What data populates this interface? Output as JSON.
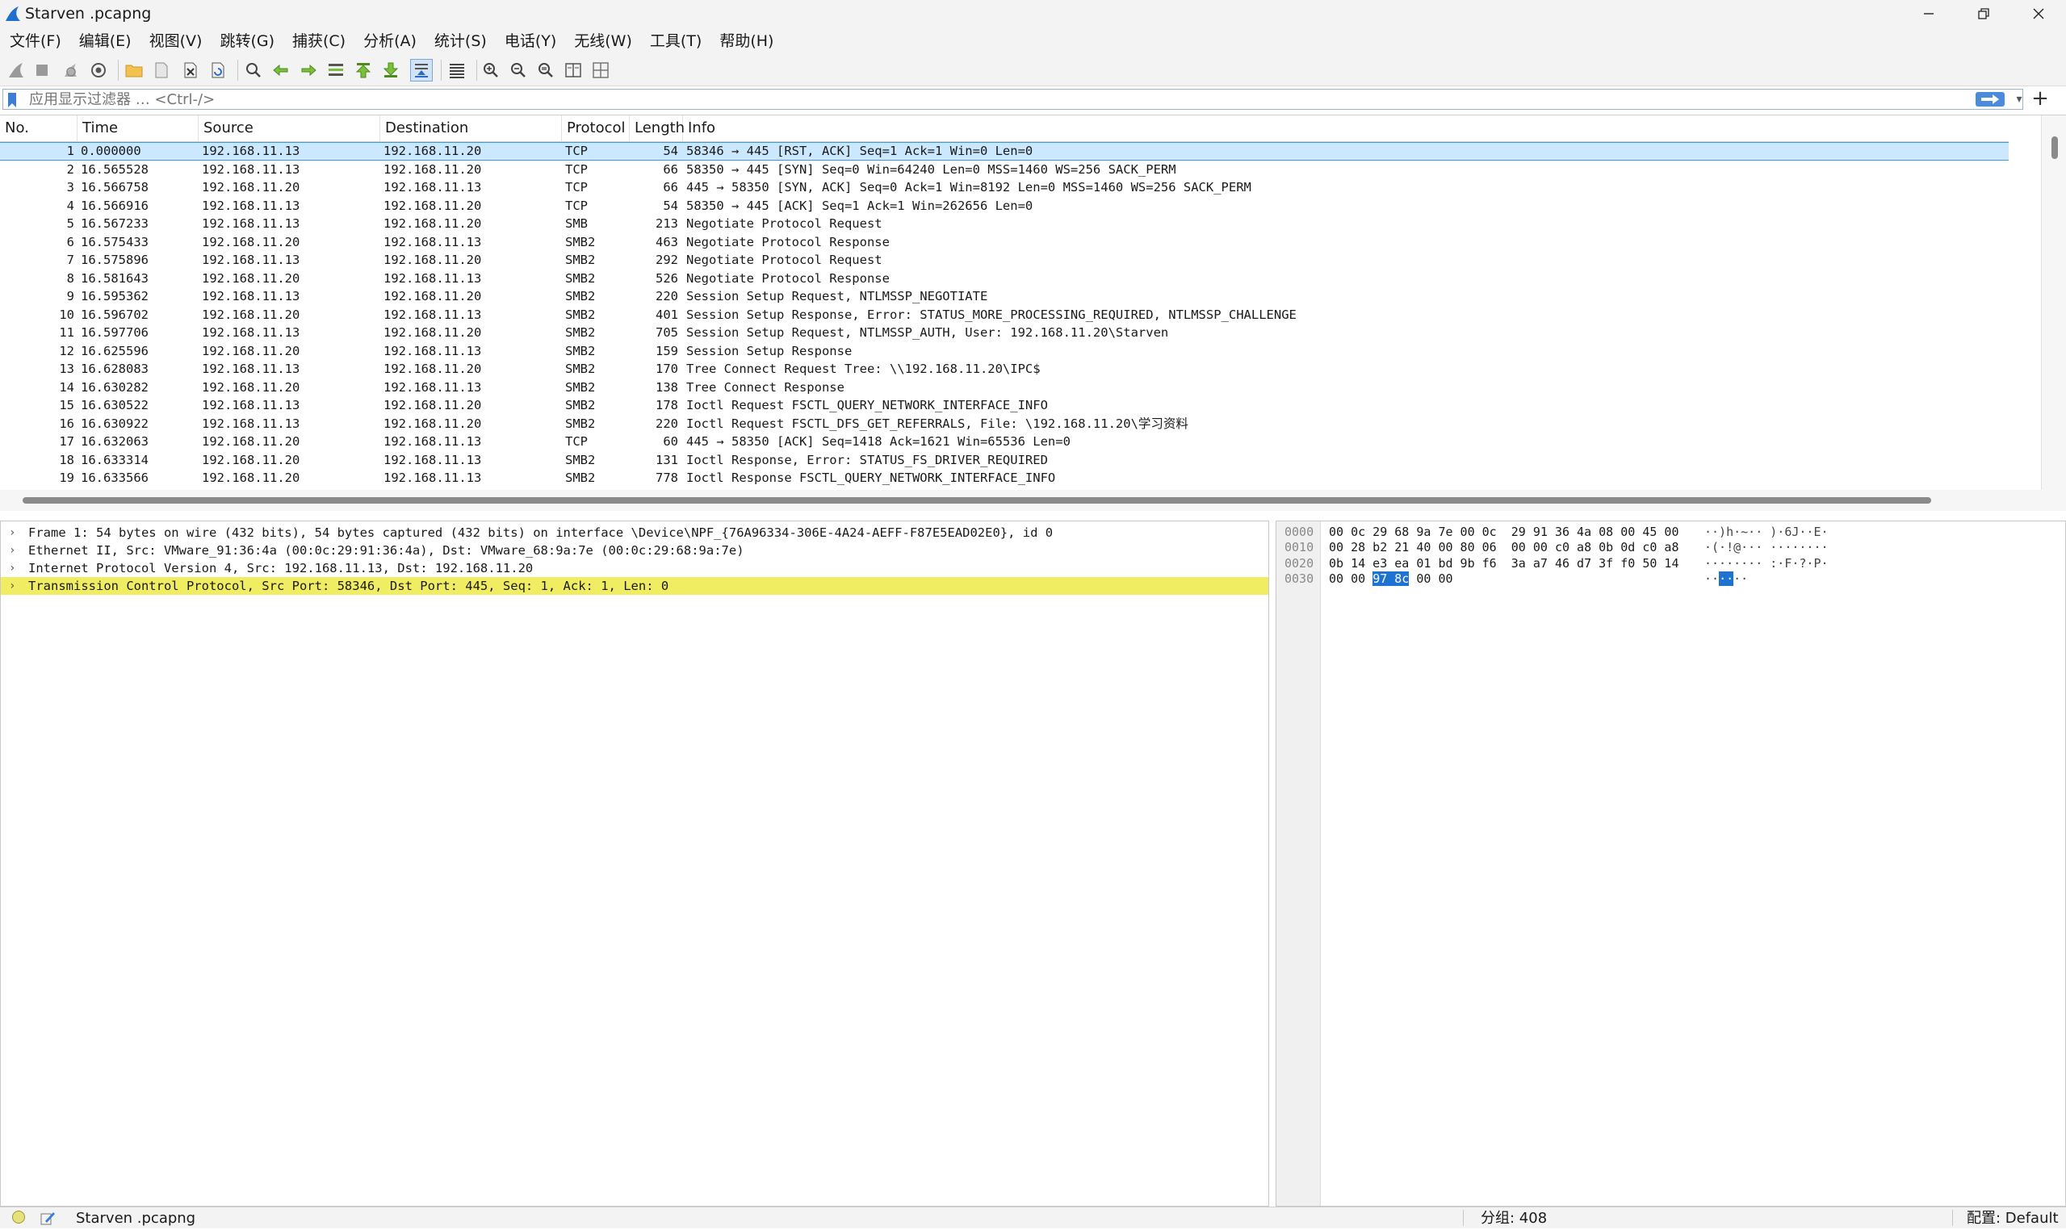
{
  "window": {
    "title": "Starven .pcapng",
    "controls": [
      "minimize",
      "restore",
      "close"
    ]
  },
  "menu": [
    "文件(F)",
    "编辑(E)",
    "视图(V)",
    "跳转(G)",
    "捕获(C)",
    "分析(A)",
    "统计(S)",
    "电话(Y)",
    "无线(W)",
    "工具(T)",
    "帮助(H)"
  ],
  "toolbar": {
    "icons": [
      "shark-fin-start-icon",
      "stop-capture-icon",
      "restart-capture-icon",
      "capture-options-icon",
      "open-file-icon",
      "save-file-icon",
      "close-file-icon",
      "reload-file-icon",
      "find-packet-icon",
      "go-back-icon",
      "go-forward-icon",
      "go-to-packet-icon",
      "go-first-icon",
      "go-last-icon",
      "autoscroll-icon",
      "colorize-icon",
      "zoom-in-icon",
      "zoom-out-icon",
      "zoom-normal-icon",
      "resize-columns-icon",
      "expand-subtrees-icon"
    ]
  },
  "filter": {
    "placeholder": "应用显示过滤器 … <Ctrl-/>",
    "value": ""
  },
  "packet_list": {
    "columns": [
      "No.",
      "Time",
      "Source",
      "Destination",
      "Protocol",
      "Length",
      "Info"
    ],
    "rows": [
      {
        "no": "1",
        "time": "0.000000",
        "src": "192.168.11.13",
        "dst": "192.168.11.20",
        "proto": "TCP",
        "len": "54",
        "info": "58346 → 445 [RST, ACK] Seq=1 Ack=1 Win=0 Len=0"
      },
      {
        "no": "2",
        "time": "16.565528",
        "src": "192.168.11.13",
        "dst": "192.168.11.20",
        "proto": "TCP",
        "len": "66",
        "info": "58350 → 445 [SYN] Seq=0 Win=64240 Len=0 MSS=1460 WS=256 SACK_PERM"
      },
      {
        "no": "3",
        "time": "16.566758",
        "src": "192.168.11.20",
        "dst": "192.168.11.13",
        "proto": "TCP",
        "len": "66",
        "info": "445 → 58350 [SYN, ACK] Seq=0 Ack=1 Win=8192 Len=0 MSS=1460 WS=256 SACK_PERM"
      },
      {
        "no": "4",
        "time": "16.566916",
        "src": "192.168.11.13",
        "dst": "192.168.11.20",
        "proto": "TCP",
        "len": "54",
        "info": "58350 → 445 [ACK] Seq=1 Ack=1 Win=262656 Len=0"
      },
      {
        "no": "5",
        "time": "16.567233",
        "src": "192.168.11.13",
        "dst": "192.168.11.20",
        "proto": "SMB",
        "len": "213",
        "info": "Negotiate Protocol Request"
      },
      {
        "no": "6",
        "time": "16.575433",
        "src": "192.168.11.20",
        "dst": "192.168.11.13",
        "proto": "SMB2",
        "len": "463",
        "info": "Negotiate Protocol Response"
      },
      {
        "no": "7",
        "time": "16.575896",
        "src": "192.168.11.13",
        "dst": "192.168.11.20",
        "proto": "SMB2",
        "len": "292",
        "info": "Negotiate Protocol Request"
      },
      {
        "no": "8",
        "time": "16.581643",
        "src": "192.168.11.20",
        "dst": "192.168.11.13",
        "proto": "SMB2",
        "len": "526",
        "info": "Negotiate Protocol Response"
      },
      {
        "no": "9",
        "time": "16.595362",
        "src": "192.168.11.13",
        "dst": "192.168.11.20",
        "proto": "SMB2",
        "len": "220",
        "info": "Session Setup Request, NTLMSSP_NEGOTIATE"
      },
      {
        "no": "10",
        "time": "16.596702",
        "src": "192.168.11.20",
        "dst": "192.168.11.13",
        "proto": "SMB2",
        "len": "401",
        "info": "Session Setup Response, Error: STATUS_MORE_PROCESSING_REQUIRED, NTLMSSP_CHALLENGE"
      },
      {
        "no": "11",
        "time": "16.597706",
        "src": "192.168.11.13",
        "dst": "192.168.11.20",
        "proto": "SMB2",
        "len": "705",
        "info": "Session Setup Request, NTLMSSP_AUTH, User: 192.168.11.20\\Starven"
      },
      {
        "no": "12",
        "time": "16.625596",
        "src": "192.168.11.20",
        "dst": "192.168.11.13",
        "proto": "SMB2",
        "len": "159",
        "info": "Session Setup Response"
      },
      {
        "no": "13",
        "time": "16.628083",
        "src": "192.168.11.13",
        "dst": "192.168.11.20",
        "proto": "SMB2",
        "len": "170",
        "info": "Tree Connect Request Tree: \\\\192.168.11.20\\IPC$"
      },
      {
        "no": "14",
        "time": "16.630282",
        "src": "192.168.11.20",
        "dst": "192.168.11.13",
        "proto": "SMB2",
        "len": "138",
        "info": "Tree Connect Response"
      },
      {
        "no": "15",
        "time": "16.630522",
        "src": "192.168.11.13",
        "dst": "192.168.11.20",
        "proto": "SMB2",
        "len": "178",
        "info": "Ioctl Request FSCTL_QUERY_NETWORK_INTERFACE_INFO"
      },
      {
        "no": "16",
        "time": "16.630922",
        "src": "192.168.11.13",
        "dst": "192.168.11.20",
        "proto": "SMB2",
        "len": "220",
        "info": "Ioctl Request FSCTL_DFS_GET_REFERRALS, File: \\192.168.11.20\\学习资料"
      },
      {
        "no": "17",
        "time": "16.632063",
        "src": "192.168.11.20",
        "dst": "192.168.11.13",
        "proto": "TCP",
        "len": "60",
        "info": "445 → 58350 [ACK] Seq=1418 Ack=1621 Win=65536 Len=0"
      },
      {
        "no": "18",
        "time": "16.633314",
        "src": "192.168.11.20",
        "dst": "192.168.11.13",
        "proto": "SMB2",
        "len": "131",
        "info": "Ioctl Response, Error: STATUS_FS_DRIVER_REQUIRED"
      },
      {
        "no": "19",
        "time": "16.633566",
        "src": "192.168.11.20",
        "dst": "192.168.11.13",
        "proto": "SMB2",
        "len": "778",
        "info": "Ioctl Response FSCTL_QUERY_NETWORK_INTERFACE_INFO"
      }
    ],
    "selected_row": 0
  },
  "packet_details": [
    {
      "text": "Frame 1: 54 bytes on wire (432 bits), 54 bytes captured (432 bits) on interface \\Device\\NPF_{76A96334-306E-4A24-AEFF-F87E5EAD02E0}, id 0",
      "arrow": "›",
      "selected": false
    },
    {
      "text": "Ethernet II, Src: VMware_91:36:4a (00:0c:29:91:36:4a), Dst: VMware_68:9a:7e (00:0c:29:68:9a:7e)",
      "arrow": "›",
      "selected": false
    },
    {
      "text": "Internet Protocol Version 4, Src: 192.168.11.13, Dst: 192.168.11.20",
      "arrow": "›",
      "selected": false
    },
    {
      "text": "Transmission Control Protocol, Src Port: 58346, Dst Port: 445, Seq: 1, Ack: 1, Len: 0",
      "arrow": "›",
      "selected": true
    }
  ],
  "packet_bytes": [
    {
      "offset": "0000",
      "hex_before": "00 0c 29 68 9a 7e 00 0c  29 91 36 4a 08 00 45 00",
      "hex_hl": "",
      "hex_after": "",
      "ascii_before": "··)h·~·· )·6J··E·",
      "ascii_hl": "",
      "ascii_after": ""
    },
    {
      "offset": "0010",
      "hex_before": "00 28 b2 21 40 00 80 06  00 00 c0 a8 0b 0d c0 a8",
      "hex_hl": "",
      "hex_after": "",
      "ascii_before": "·(·!@··· ········",
      "ascii_hl": "",
      "ascii_after": ""
    },
    {
      "offset": "0020",
      "hex_before": "0b 14 e3 ea 01 bd 9b f6  3a a7 46 d7 3f f0 50 14",
      "hex_hl": "",
      "hex_after": "",
      "ascii_before": "········ :·F·?·P·",
      "ascii_hl": "",
      "ascii_after": ""
    },
    {
      "offset": "0030",
      "hex_before": "00 00 ",
      "hex_hl": "97 8c",
      "hex_after": " 00 00",
      "ascii_before": "··",
      "ascii_hl": "··",
      "ascii_after": "··"
    }
  ],
  "status": {
    "file": "Starven .pcapng",
    "packets": "分组: 408",
    "profile": "配置: Default"
  },
  "colors": {
    "selected_row": "#cce8ff",
    "detail_highlight": "#f1ed62",
    "byte_highlight": "#1e73d2",
    "shark_fin": "#1e6fd0"
  }
}
